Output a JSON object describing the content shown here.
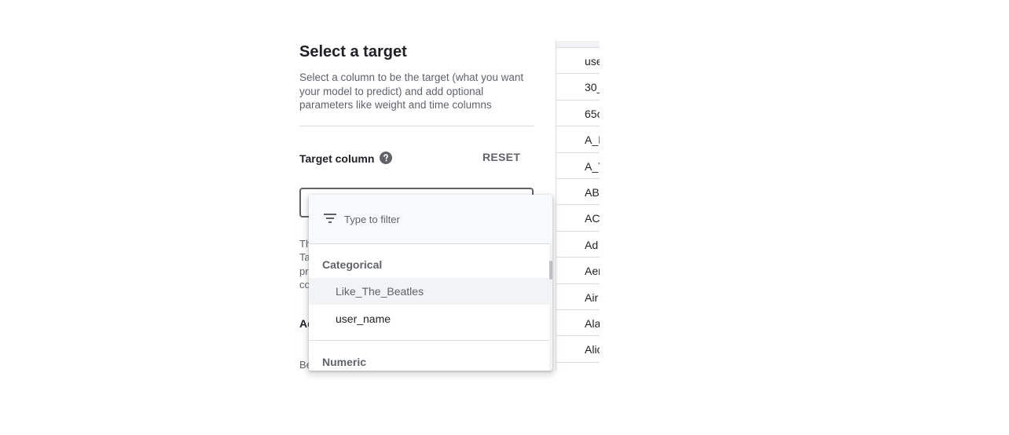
{
  "panel": {
    "title": "Select a target",
    "description": "Select a column to be the target (what you want your model to predict) and add optional parameters like weight and time columns",
    "target_column_label": "Target column",
    "reset_label": "RESET",
    "hidden_text_lines": [
      "Th",
      "Ta",
      "pr",
      "co"
    ],
    "section_heading_partial": "Ad",
    "section_text_partial": "Be"
  },
  "dropdown": {
    "filter_placeholder": "Type to filter",
    "groups": [
      {
        "label": "Categorical",
        "options": [
          "Like_The_Beatles",
          "user_name"
        ],
        "highlighted": "Like_The_Beatles"
      },
      {
        "label": "Numeric",
        "options": []
      }
    ]
  },
  "table_right": {
    "rows": [
      "use",
      "30_",
      "65c",
      "A_I",
      "A_T",
      "AB",
      "AC",
      "Ad",
      "Aer",
      "Air",
      "Ala",
      "Alic"
    ]
  },
  "icons": {
    "help": "help-circle-icon",
    "filter": "filter-list-icon"
  },
  "colors": {
    "text_primary": "#202124",
    "text_secondary": "#5f6368",
    "divider": "#dadce0",
    "highlight_bg": "#f1f3f4"
  }
}
